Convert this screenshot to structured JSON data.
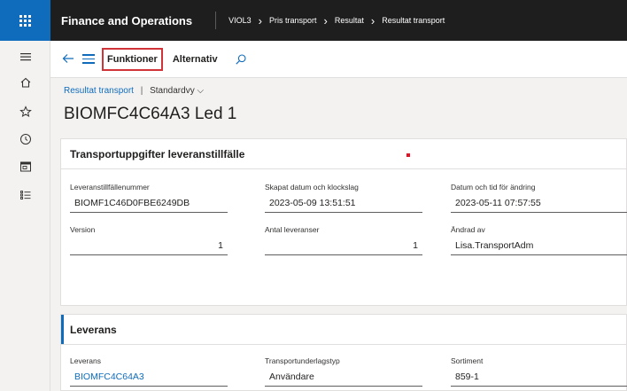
{
  "app": {
    "title": "Finance and Operations",
    "company": "VIOL3",
    "breadcrumbs": [
      "Pris transport",
      "Resultat",
      "Resultat transport"
    ]
  },
  "action_pane": {
    "tabs": [
      {
        "label": "Funktioner",
        "highlighted": true
      },
      {
        "label": "Alternativ",
        "highlighted": false
      }
    ]
  },
  "header": {
    "form_link": "Resultat transport",
    "separator": "|",
    "view_label": "Standardvy",
    "record_title": "BIOMFC4C64A3 Led 1"
  },
  "card_transport": {
    "title": "Transportuppgifter leveranstillfälle",
    "fields": [
      {
        "label": "Leveranstillfällenummer",
        "value": "BIOMF1C46D0FBE6249DB"
      },
      {
        "label": "Skapat datum och klockslag",
        "value": "2023-05-09 13:51:51"
      },
      {
        "label": "Datum och tid för ändring",
        "value": "2023-05-11 07:57:55"
      },
      {
        "label": "Version",
        "value": "1"
      },
      {
        "label": "Antal leveranser",
        "value": "1"
      },
      {
        "label": "Ändrad av",
        "value": "Lisa.TransportAdm"
      }
    ]
  },
  "card_leverans": {
    "title": "Leverans",
    "fields": [
      {
        "label": "Leverans",
        "value": "BIOMFC4C64A3"
      },
      {
        "label": "Transportunderlagstyp",
        "value": "Användare"
      },
      {
        "label": "Sortiment",
        "value": "859-1"
      }
    ]
  },
  "colors": {
    "accent": "#0f6cbd",
    "topbar": "#1e1e1e",
    "highlight_border": "#d13438"
  }
}
